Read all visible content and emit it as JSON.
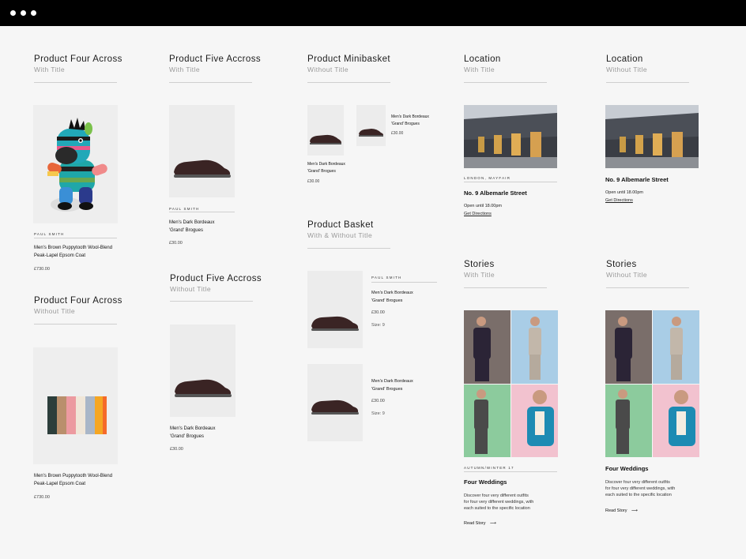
{
  "sections": {
    "four_with": {
      "title": "Product Four Across",
      "subtitle": "With Title"
    },
    "four_without": {
      "title": "Product Four Across",
      "subtitle": "Without Title"
    },
    "five_with": {
      "title": "Product Five Accross",
      "subtitle": "With Title"
    },
    "five_without": {
      "title": "Product Five Accross",
      "subtitle": "Without Title"
    },
    "minibasket": {
      "title": "Product Minibasket",
      "subtitle": "Without Title"
    },
    "basket": {
      "title": "Product Basket",
      "subtitle": "With & Without Title"
    },
    "location_with": {
      "title": "Location",
      "subtitle": "With Title"
    },
    "location_without": {
      "title": "Location",
      "subtitle": "Without Title"
    },
    "stories_with": {
      "title": "Stories",
      "subtitle": "With Title"
    },
    "stories_without": {
      "title": "Stories",
      "subtitle": "Without Title"
    }
  },
  "products": {
    "zebra": {
      "brand": "PAUL SMITH",
      "name_line1": "Men's Brown Puppytooth Wool-Blend",
      "name_line2": "Peak-Lapel Epsom Coat",
      "price": "£730.00"
    },
    "wallet": {
      "name_line1": "Men's Brown Puppytooth Wool-Blend",
      "name_line2": "Peak-Lapel Epsom Coat",
      "price": "£730.00"
    },
    "shoe_five_with": {
      "brand": "PAUL SMITH",
      "name_line1": "Men's Dark Bordeaux",
      "name_line2": "'Grand' Brogues",
      "price": "£30.00"
    },
    "shoe_five_without": {
      "name_line1": "Men's Dark Bordeaux",
      "name_line2": "'Grand' Brogues",
      "price": "£30.00"
    },
    "mini_1": {
      "name_line1": "Men's Dark Bordeaux",
      "name_line2": "'Grand' Brogues",
      "price": "£30.00"
    },
    "mini_2": {
      "name_line1": "Men's Dark Bordeaux",
      "name_line2": "'Grand' Brogues",
      "price": "£30.00"
    },
    "basket_1": {
      "brand": "PAUL SMITH",
      "name_line1": "Men's Dark Bordeaux",
      "name_line2": "'Grand' Brogues",
      "price": "£30.00",
      "size": "Size: 9"
    },
    "basket_2": {
      "name_line1": "Men's Dark Bordeaux",
      "name_line2": "'Grand' Brogues",
      "price": "£30.00",
      "size": "Size: 9"
    }
  },
  "locations": {
    "with": {
      "area": "LONDON, MAYFAIR",
      "name": "No. 9 Albemarle Street",
      "hours": "Open until 18.00pm",
      "directions": "Get Directions"
    },
    "without": {
      "name": "No. 9 Albemarle Street",
      "hours": "Open until 18.00pm",
      "directions": "Get Directions"
    }
  },
  "stories": {
    "with": {
      "tag": "AUTUMN/WINTER 17",
      "title": "Four Weddings",
      "desc_line1": "Discover four very different outfits",
      "desc_line2": "for four very different weddings, with",
      "desc_line3": "each suited to the specific location",
      "read": "Read Story",
      "arrow": "⟶"
    },
    "without": {
      "title": "Four Weddings",
      "desc_line1": "Discover four very different outfits",
      "desc_line2": "for four very different weddings, with",
      "desc_line3": "each suited to the specific location",
      "read": "Read Story",
      "arrow": "⟶"
    }
  },
  "colors": {
    "topbar": "#000000",
    "background": "#f6f6f6",
    "story_tl": "#7a6e6a",
    "story_tr": "#a9cde6",
    "story_bl": "#8ccb9d",
    "story_br": "#f2c2cf"
  }
}
